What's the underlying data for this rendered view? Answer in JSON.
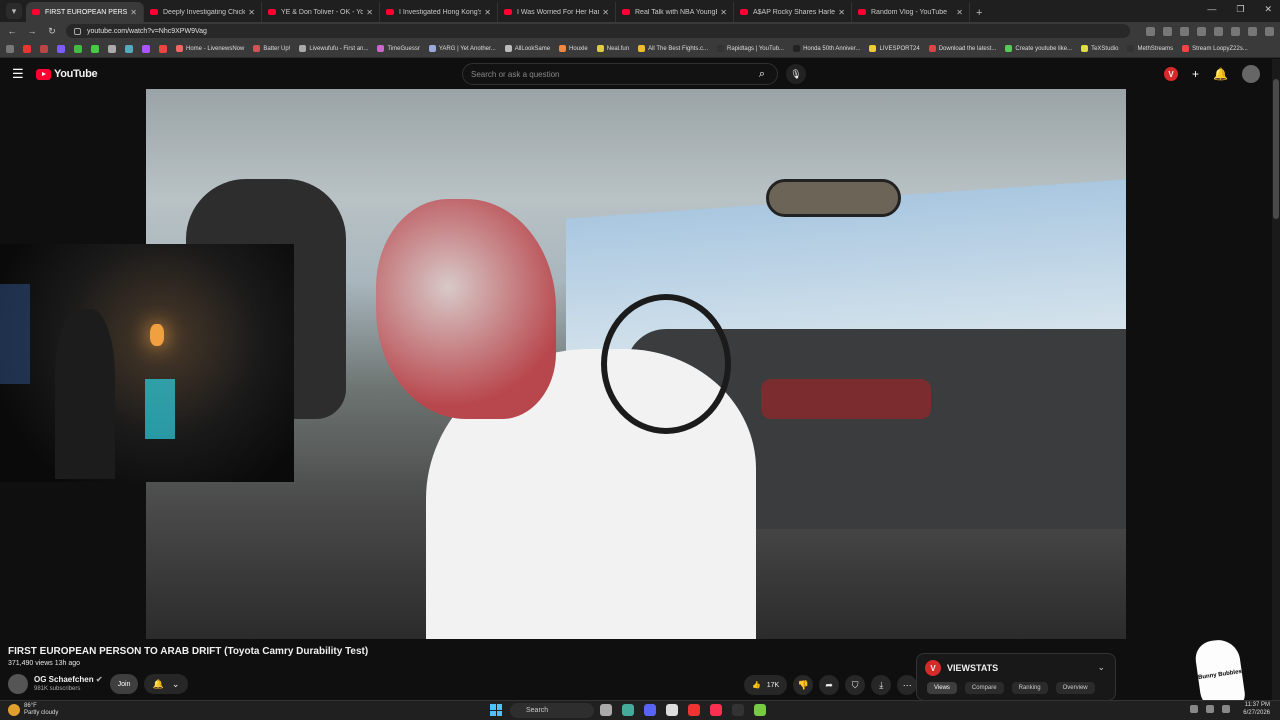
{
  "browser": {
    "tabs": [
      {
        "label": "FIRST EUROPEAN PERSON",
        "active": true
      },
      {
        "label": "Deeply Investigating Chick-Fil-",
        "active": false
      },
      {
        "label": "YE & Don Toliver - OK - YouTu",
        "active": false
      },
      {
        "label": "I Investigated Hong Kong's Lo",
        "active": false
      },
      {
        "label": "I Was Worried For Her Hand - ",
        "active": false
      },
      {
        "label": "Real Talk with NBA YoungBoy ",
        "active": false
      },
      {
        "label": "A$AP Rocky Shares Harlem St",
        "active": false
      },
      {
        "label": "Random Vlog - YouTube",
        "active": false
      }
    ],
    "url": "youtube.com/watch?v=Nhc9XPW9Vag",
    "bookmarks": [
      "Home - LivenewsNow",
      "Batter Up!",
      "Livewufufu - First an...",
      "TimeGuessr",
      "YARG | Yet Another...",
      "AllLookSame",
      "Houxle",
      "Neal.fun",
      "All The Best Fights.c...",
      "Rapidtags | YouTub...",
      "Honda 50th Anniver...",
      "LIVESPORT24",
      "Download the latest...",
      "Create youtube like...",
      "TeXStudio",
      "MethStreams",
      "Stream LoopyZ22s..."
    ]
  },
  "youtube": {
    "logo_text": "YouTube",
    "search_placeholder": "Search or ask a question",
    "video": {
      "title": "FIRST EUROPEAN PERSON TO ARAB DRIFT (Toyota Camry Durability Test)",
      "meta": "371,490 views  13h ago",
      "channel": "OG Schaefchen",
      "subscribers": "981K subscribers",
      "join_label": "Join",
      "likes": "17K"
    },
    "viewstats": {
      "title": "VIEWSTATS",
      "logo_letter": "V",
      "tabs": [
        "Views",
        "Compare",
        "Ranking",
        "Overview"
      ]
    },
    "header_badge": "V"
  },
  "sticker_text": "Bunny Bubbles",
  "taskbar": {
    "temperature": "86°F",
    "weather": "Partly cloudy",
    "search_label": "Search",
    "time": "11:37 PM",
    "date": "6/27/2026"
  }
}
